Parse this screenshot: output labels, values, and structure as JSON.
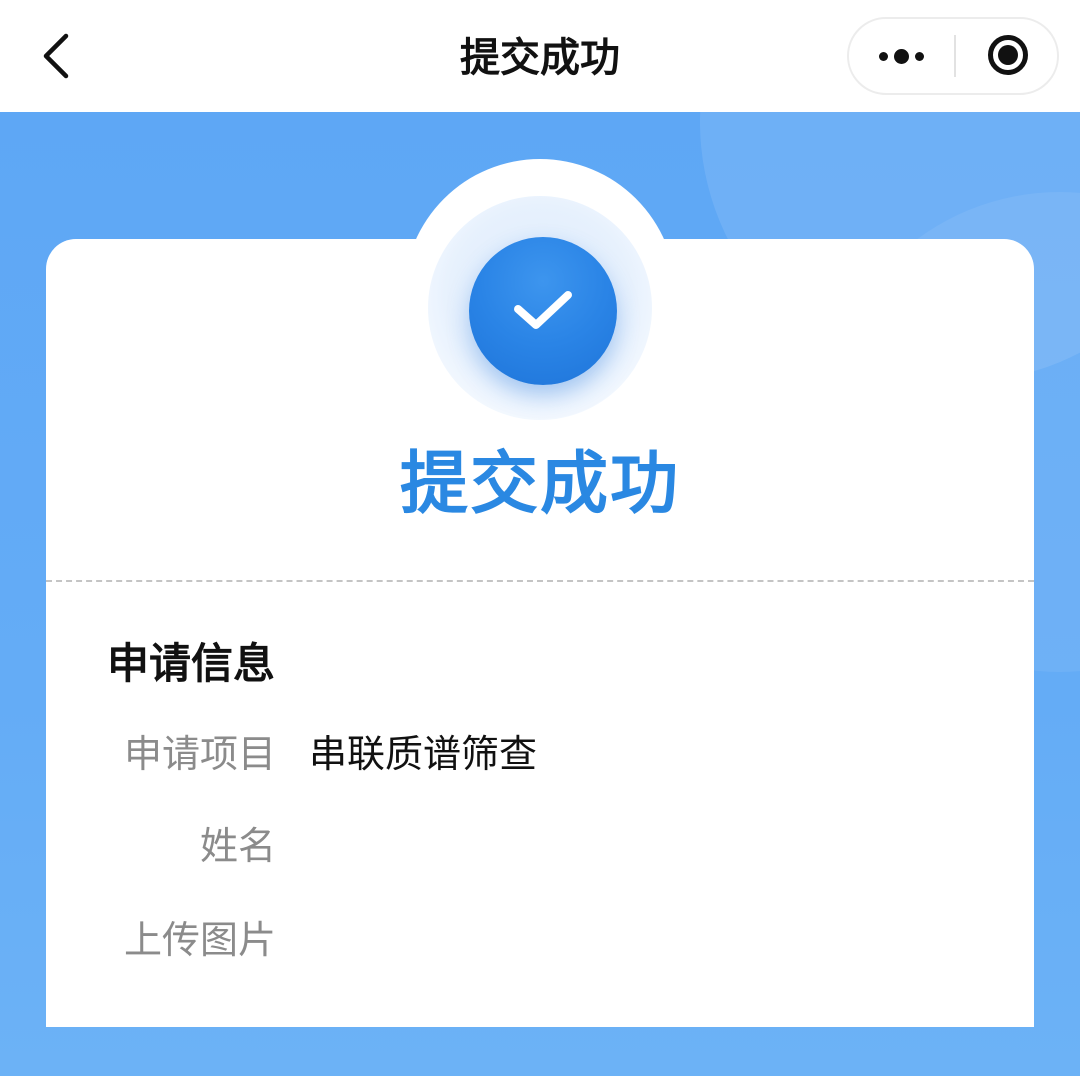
{
  "navbar": {
    "title": "提交成功"
  },
  "success": {
    "title": "提交成功",
    "accent_color": "#2a88e2",
    "background_color": "#5ea7f5"
  },
  "icons": {
    "back": "chevron-left-icon",
    "more": "more-dots-icon",
    "close": "capsule-close-icon",
    "success": "check-circle-icon"
  },
  "info": {
    "title": "申请信息",
    "rows": [
      {
        "label": "申请项目",
        "value": "串联质谱筛查"
      },
      {
        "label": "姓名",
        "value": ""
      },
      {
        "label": "上传图片",
        "value": ""
      }
    ]
  }
}
